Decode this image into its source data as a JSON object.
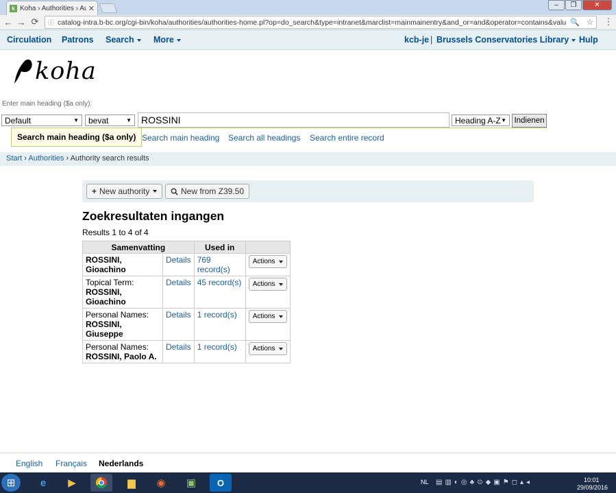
{
  "browser": {
    "tab_title": "Koha › Authorities › Auth",
    "tab_favicon": "k",
    "url": "catalog-intra.b-bc.org/cgi-bin/koha/authorities/authorities-home.pl?op=do_search&type=intranet&marclist=mainmainentry&and_or=and&operator=contains&value=ROSSI"
  },
  "nav": {
    "circulation": "Circulation",
    "patrons": "Patrons",
    "search": "Search",
    "more": "More",
    "user": "kcb-je",
    "separator": "|",
    "library": "Brussels Conservatories Library",
    "help": "Hulp"
  },
  "logo_text": "koha",
  "search": {
    "hint": "Enter main heading ($a only):",
    "marclist_value": "Default",
    "operator_value": "bevat",
    "query_value": "ROSSINI",
    "order_value": "Heading A-Z",
    "submit_label": "Indienen",
    "tabs": [
      "Search main heading ($a only)",
      "Search main heading",
      "Search all headings",
      "Search entire record"
    ]
  },
  "breadcrumb": {
    "start": "Start",
    "sep": "›",
    "authorities": "Authorities",
    "current": "Authority search results"
  },
  "toolbar": {
    "new_authority": "New authority",
    "new_from_z3950": "New from Z39.50"
  },
  "results": {
    "heading": "Zoekresultaten ingangen",
    "count_text": "Results 1 to 4 of 4",
    "columns": [
      "Samenvatting",
      "Used in",
      ""
    ],
    "rows": [
      {
        "type": "",
        "name": "ROSSINI, Gioachino",
        "details": "Details",
        "used": "769 record(s)",
        "actions": "Actions"
      },
      {
        "type": "Topical Term:",
        "name": "ROSSINI, Gioachino",
        "details": "Details",
        "used": "45 record(s)",
        "actions": "Actions"
      },
      {
        "type": "Personal Names:",
        "name": "ROSSINI, Giuseppe",
        "details": "Details",
        "used": "1 record(s)",
        "actions": "Actions"
      },
      {
        "type": "Personal Names:",
        "name": "ROSSINI, Paolo A.",
        "details": "Details",
        "used": "1 record(s)",
        "actions": "Actions"
      }
    ]
  },
  "footer": {
    "languages": [
      "English",
      "Français",
      "Nederlands"
    ],
    "active": "Nederlands"
  },
  "taskbar": {
    "lang": "NL",
    "time": "10:01",
    "date": "29/09/2016"
  },
  "colors": {
    "link": "#1a5fa6",
    "nav_bg": "#e6f0f2",
    "taskbar": "#1c2b45"
  }
}
